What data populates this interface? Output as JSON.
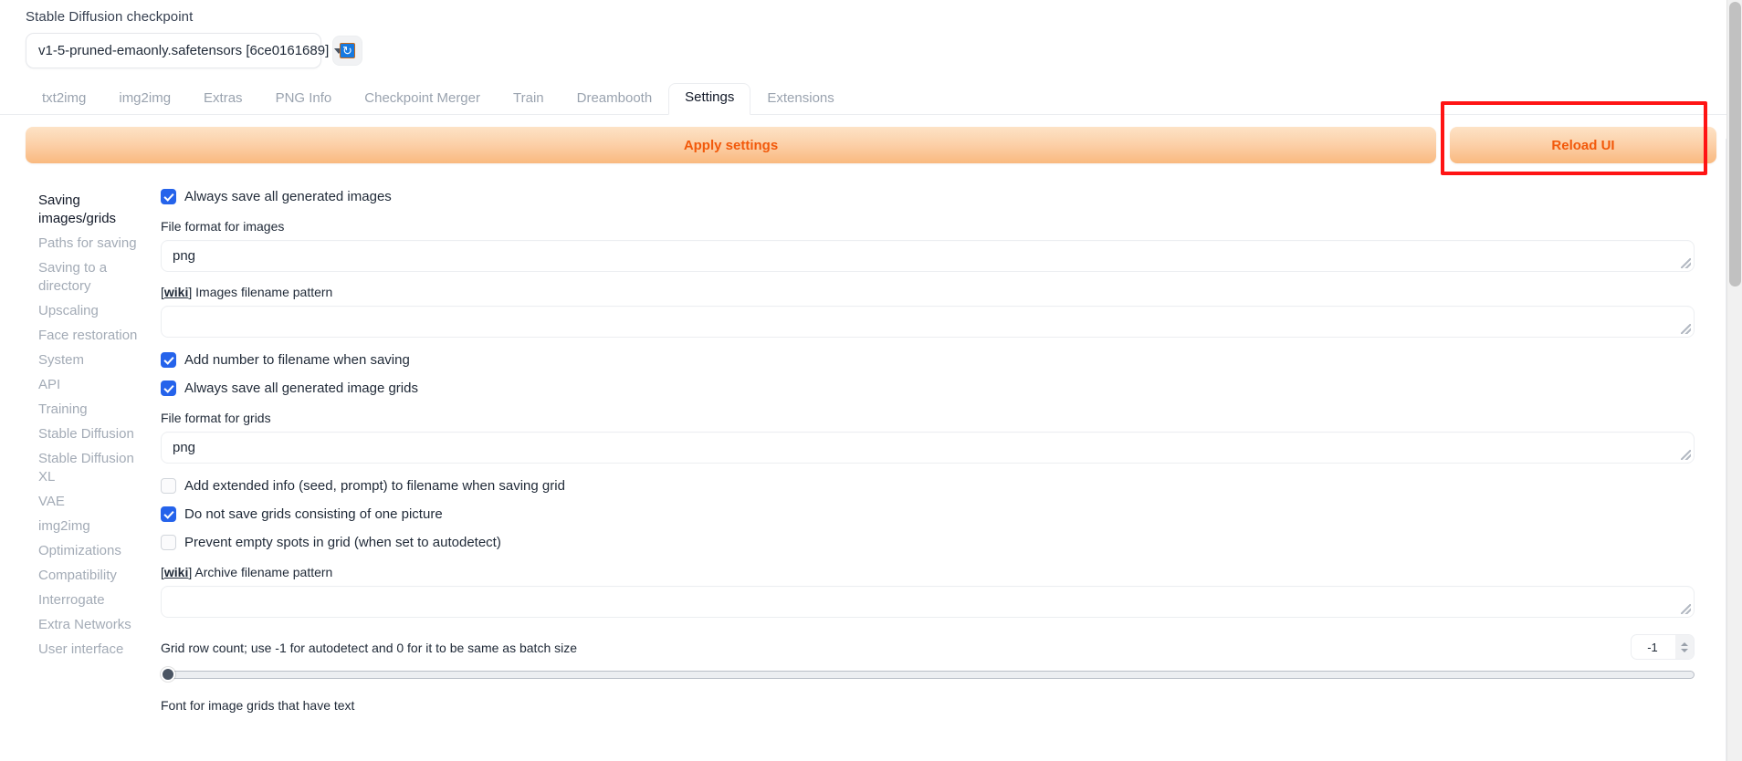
{
  "checkpoint": {
    "label": "Stable Diffusion checkpoint",
    "value": "v1-5-pruned-emaonly.safetensors [6ce0161689]",
    "refresh_icon": "refresh-icon",
    "caret_icon": "chevron-down-icon"
  },
  "tabs": [
    {
      "label": "txt2img",
      "active": false
    },
    {
      "label": "img2img",
      "active": false
    },
    {
      "label": "Extras",
      "active": false
    },
    {
      "label": "PNG Info",
      "active": false
    },
    {
      "label": "Checkpoint Merger",
      "active": false
    },
    {
      "label": "Train",
      "active": false
    },
    {
      "label": "Dreambooth",
      "active": false
    },
    {
      "label": "Settings",
      "active": true
    },
    {
      "label": "Extensions",
      "active": false
    }
  ],
  "actions": {
    "apply_label": "Apply settings",
    "reload_label": "Reload UI",
    "accent_color": "#f2590b",
    "highlight_color": "#ff1414"
  },
  "sidebar": {
    "items": [
      {
        "label": "Saving images/grids",
        "active": true
      },
      {
        "label": "Paths for saving",
        "active": false
      },
      {
        "label": "Saving to a directory",
        "active": false
      },
      {
        "label": "Upscaling",
        "active": false
      },
      {
        "label": "Face restoration",
        "active": false
      },
      {
        "label": "System",
        "active": false
      },
      {
        "label": "API",
        "active": false
      },
      {
        "label": "Training",
        "active": false
      },
      {
        "label": "Stable Diffusion",
        "active": false
      },
      {
        "label": "Stable Diffusion XL",
        "active": false
      },
      {
        "label": "VAE",
        "active": false
      },
      {
        "label": "img2img",
        "active": false
      },
      {
        "label": "Optimizations",
        "active": false
      },
      {
        "label": "Compatibility",
        "active": false
      },
      {
        "label": "Interrogate",
        "active": false
      },
      {
        "label": "Extra Networks",
        "active": false
      },
      {
        "label": "User interface",
        "active": false
      }
    ]
  },
  "settings": {
    "check_always_save_images": {
      "label": "Always save all generated images",
      "checked": true
    },
    "file_format_images": {
      "label": "File format for images",
      "value": "png"
    },
    "images_filename_pattern": {
      "wiki": "wiki",
      "label": "Images filename pattern",
      "value": ""
    },
    "check_add_number": {
      "label": "Add number to filename when saving",
      "checked": true
    },
    "check_always_save_grids": {
      "label": "Always save all generated image grids",
      "checked": true
    },
    "file_format_grids": {
      "label": "File format for grids",
      "value": "png"
    },
    "check_extended_info": {
      "label": "Add extended info (seed, prompt) to filename when saving grid",
      "checked": false
    },
    "check_no_single_grids": {
      "label": "Do not save grids consisting of one picture",
      "checked": true
    },
    "check_prevent_empty": {
      "label": "Prevent empty spots in grid (when set to autodetect)",
      "checked": false
    },
    "archive_filename_pattern": {
      "wiki": "wiki",
      "label": "Archive filename pattern",
      "value": ""
    },
    "grid_row_count": {
      "label": "Grid row count; use -1 for autodetect and 0 for it to be same as batch size",
      "value": "-1"
    },
    "font_for_grids": {
      "label": "Font for image grids that have text"
    }
  }
}
